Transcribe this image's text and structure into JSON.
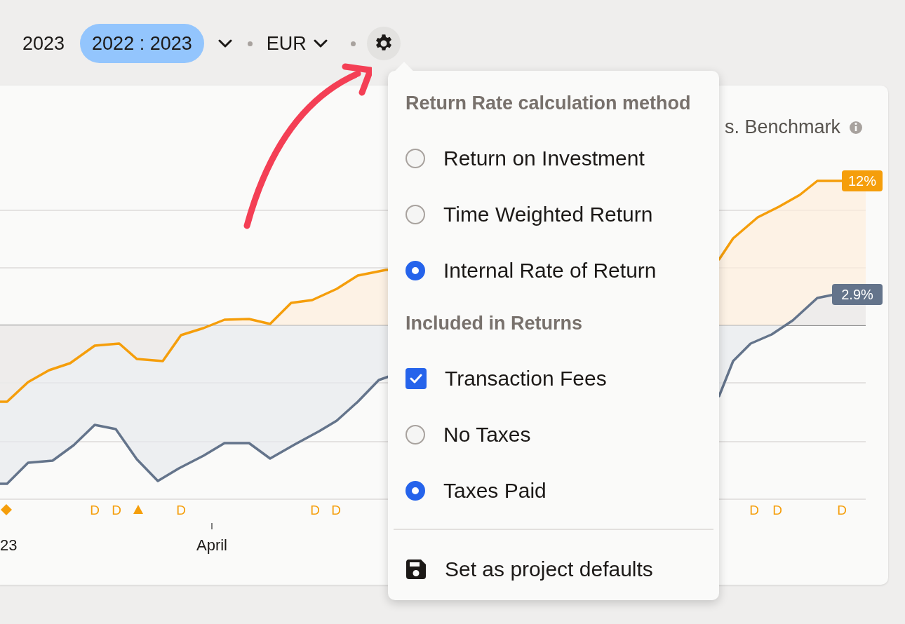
{
  "toolbar": {
    "ranges": [
      {
        "label": "2023",
        "selected": false
      },
      {
        "label": "2022 : 2023",
        "selected": true
      }
    ],
    "currency": "EUR"
  },
  "chart": {
    "title": "s. Benchmark",
    "end_labels": [
      {
        "text": "12%",
        "color": "#f59e0b"
      },
      {
        "text": "2.9%",
        "color": "#64748b"
      }
    ],
    "event_markers": [
      {
        "kind": "diamond"
      },
      {
        "kind": "letter",
        "label": "D"
      },
      {
        "kind": "letter",
        "label": "D"
      },
      {
        "kind": "triangle"
      },
      {
        "kind": "letter",
        "label": "D"
      },
      {
        "kind": "letter",
        "label": "D"
      },
      {
        "kind": "letter",
        "label": "D"
      },
      {
        "kind": "letter",
        "label": "D"
      },
      {
        "kind": "letter",
        "label": "D"
      },
      {
        "kind": "letter",
        "label": "D"
      }
    ],
    "x_labels": [
      "23",
      "April"
    ]
  },
  "settings_menu": {
    "sections": [
      {
        "heading": "Return Rate calculation method",
        "options": [
          {
            "kind": "radio",
            "label": "Return on Investment",
            "selected": false
          },
          {
            "kind": "radio",
            "label": "Time Weighted Return",
            "selected": false
          },
          {
            "kind": "radio",
            "label": "Internal Rate of Return",
            "selected": true
          }
        ]
      },
      {
        "heading": "Included in Returns",
        "options": [
          {
            "kind": "checkbox",
            "label": "Transaction Fees",
            "checked": true
          },
          {
            "kind": "radio",
            "label": "No Taxes",
            "selected": false
          },
          {
            "kind": "radio",
            "label": "Taxes Paid",
            "selected": true
          }
        ]
      }
    ],
    "action": "Set as project defaults"
  }
}
